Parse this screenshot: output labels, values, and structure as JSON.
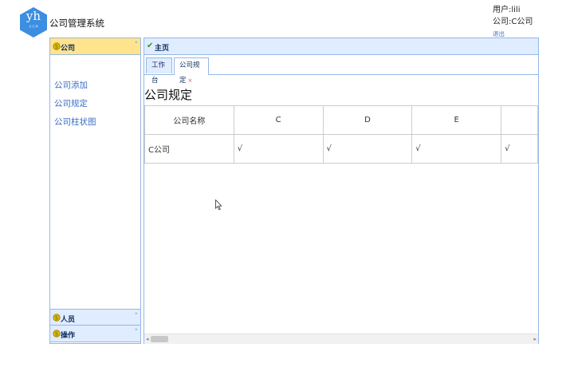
{
  "header": {
    "logo_text": "yh",
    "logo_sub": "云 汇 网",
    "app_title": "公司管理系统",
    "user_line": "用户:lili",
    "company_line": "公司:C公司",
    "logout_label": "退出"
  },
  "sidebar": {
    "active_panel": {
      "title": "公司",
      "icon": "coin-icon"
    },
    "links": [
      "公司添加",
      "公司规定",
      "公司柱状图"
    ],
    "other_panels": [
      {
        "title": "人员",
        "icon": "coin-icon"
      },
      {
        "title": "操作",
        "icon": "coin-icon"
      }
    ]
  },
  "main": {
    "header_title": "主页",
    "tabs": [
      {
        "label": "工作台",
        "closable": false,
        "active": false
      },
      {
        "label": "公司规定",
        "closable": true,
        "active": true,
        "close_label": "×"
      }
    ],
    "page_title": "公司规定",
    "table": {
      "columns": [
        "公司名称",
        "C",
        "D",
        "E",
        ""
      ],
      "rows": [
        [
          "C公司",
          "√",
          "√",
          "√",
          "√"
        ]
      ]
    }
  },
  "colors": {
    "border": "#95b8e7",
    "panel_header": "#e0ecff",
    "active_header": "#ffe48d",
    "link": "#3a6fc4",
    "logo": "#3b8ee0"
  }
}
